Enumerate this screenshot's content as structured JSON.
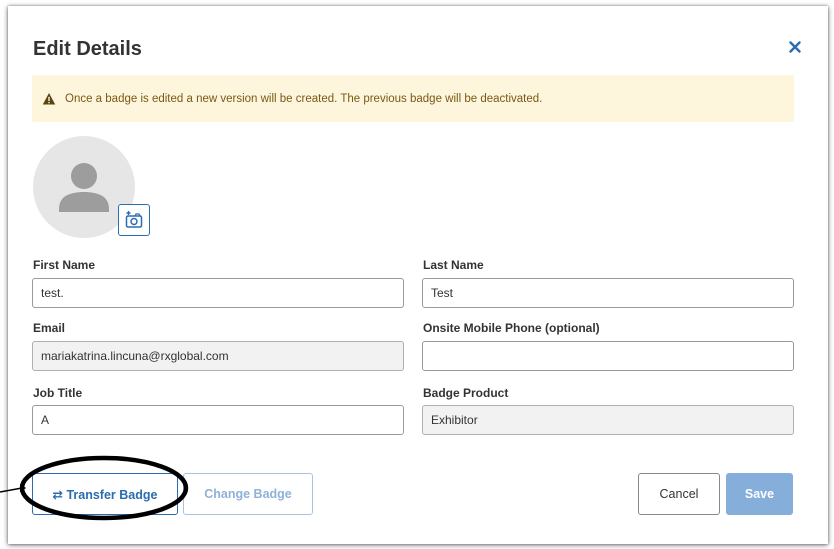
{
  "dialog": {
    "title": "Edit Details",
    "close_glyph": "×"
  },
  "alert": {
    "icon": "warning-icon",
    "text": "Once a badge is edited a new version will be created. The previous badge will be deactivated.",
    "color": "#fdf5dc"
  },
  "avatar": {
    "icon": "user-placeholder-icon",
    "camera_icon": "add-photo-icon"
  },
  "fields": {
    "first_name": {
      "label": "First Name",
      "value": "test."
    },
    "last_name": {
      "label": "Last Name",
      "value": "Test"
    },
    "email": {
      "label": "Email",
      "value": "mariakatrina.lincuna@rxglobal.com"
    },
    "mobile": {
      "label": "Onsite Mobile Phone (optional)",
      "value": ""
    },
    "job_title": {
      "label": "Job Title",
      "value": "A"
    },
    "badge_product": {
      "label": "Badge Product",
      "value": "Exhibitor"
    }
  },
  "buttons": {
    "transfer_badge": "⇄ Transfer Badge",
    "change_badge": "Change Badge",
    "cancel": "Cancel",
    "save": "Save"
  },
  "colors": {
    "accent": "#2a6db0",
    "save_disabled": "#86aedb"
  }
}
